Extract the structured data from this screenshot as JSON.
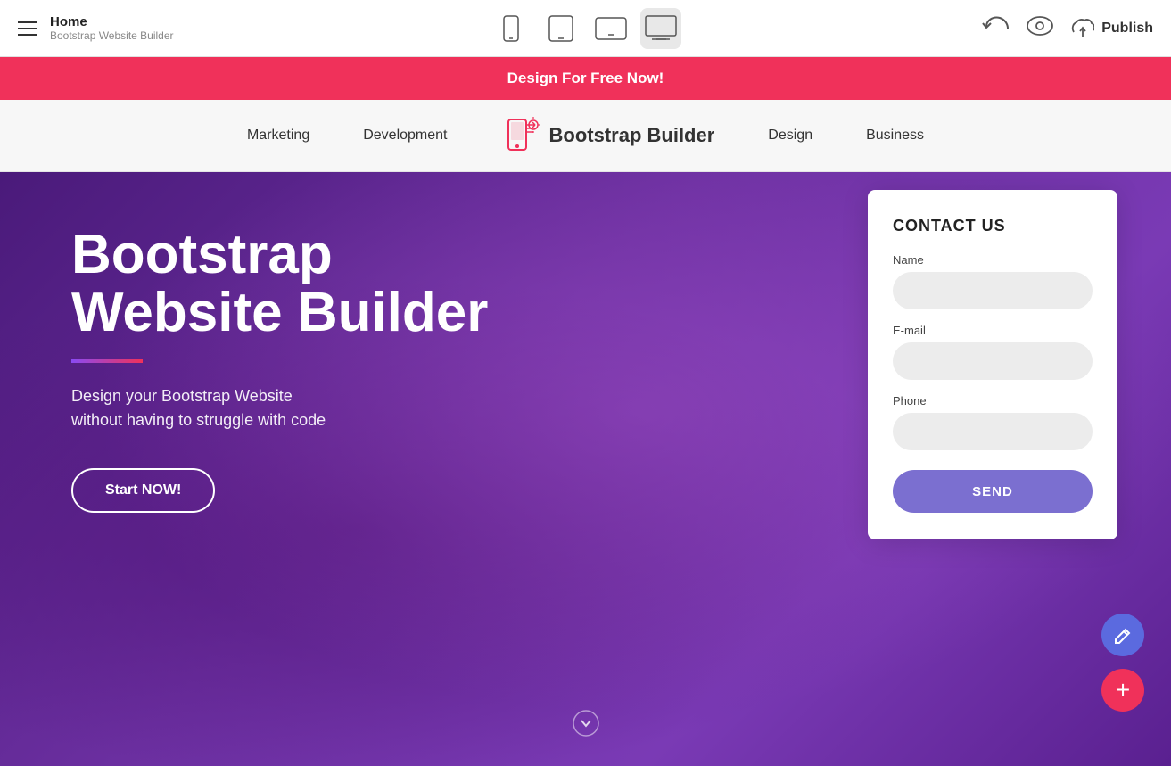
{
  "topbar": {
    "home_label": "Home",
    "subtitle": "Bootstrap Website Builder",
    "devices": [
      {
        "id": "mobile",
        "label": "Mobile"
      },
      {
        "id": "tablet",
        "label": "Tablet"
      },
      {
        "id": "tablet-landscape",
        "label": "Tablet Landscape"
      },
      {
        "id": "desktop",
        "label": "Desktop"
      }
    ],
    "active_device": "desktop",
    "publish_label": "Publish"
  },
  "promo": {
    "text": "Design For Free Now!"
  },
  "site_nav": {
    "items_left": [
      {
        "label": "Marketing"
      },
      {
        "label": "Development"
      }
    ],
    "logo_text": "Bootstrap Builder",
    "items_right": [
      {
        "label": "Design"
      },
      {
        "label": "Business"
      }
    ]
  },
  "hero": {
    "title_line1": "Bootstrap",
    "title_line2": "Website Builder",
    "subtitle": "Design your Bootstrap Website\nwithout having to struggle with code",
    "cta_label": "Start NOW!"
  },
  "contact_form": {
    "title": "CONTACT US",
    "name_label": "Name",
    "name_placeholder": "",
    "email_label": "E-mail",
    "email_placeholder": "",
    "phone_label": "Phone",
    "phone_placeholder": "",
    "send_label": "SEND"
  },
  "fab": {
    "edit_icon": "✎",
    "add_icon": "+"
  }
}
